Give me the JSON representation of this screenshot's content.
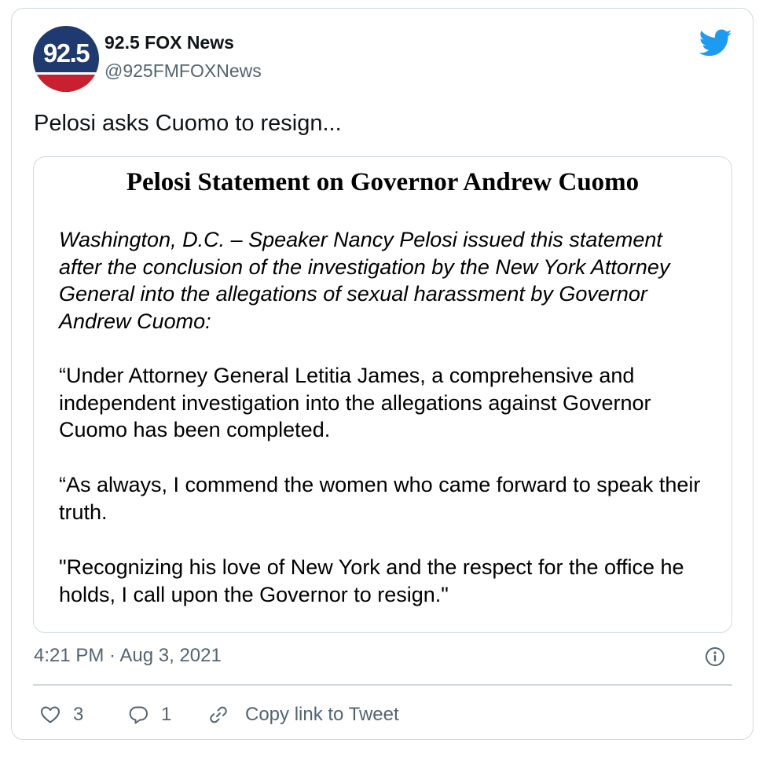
{
  "account": {
    "avatar_text": "92.5",
    "display_name": "92.5 FOX News",
    "handle": "@925FMFOXNews"
  },
  "tweet": {
    "text": "Pelosi asks Cuomo to resign...",
    "timestamp": "4:21 PM · Aug 3, 2021"
  },
  "media": {
    "title": "Pelosi Statement on Governor Andrew Cuomo",
    "intro": "Washington, D.C. – Speaker Nancy Pelosi issued this statement after the conclusion of the investigation by the New York Attorney General into the allegations of sexual harassment by Governor Andrew Cuomo:",
    "paragraphs": [
      "“Under Attorney General Letitia James, a comprehensive and independent investigation into the allegations against Governor Cuomo has been completed.",
      "“As always, I commend the women who came forward to speak their truth.",
      "\"Recognizing his love of New York and the respect for the office he holds, I call upon the Governor to resign.\""
    ]
  },
  "actions": {
    "like_count": "3",
    "reply_count": "1",
    "copy_link_label": "Copy link to Tweet"
  },
  "icons": {
    "brand": "twitter-bird-icon",
    "info": "info-icon",
    "like": "heart-icon",
    "reply": "reply-bubble-icon",
    "link": "link-icon"
  },
  "colors": {
    "twitter_blue": "#1d9bf0",
    "secondary_text": "#536471",
    "border": "#cfd9de",
    "avatar_blue": "#1f3a6e",
    "avatar_red": "#c8202f"
  }
}
